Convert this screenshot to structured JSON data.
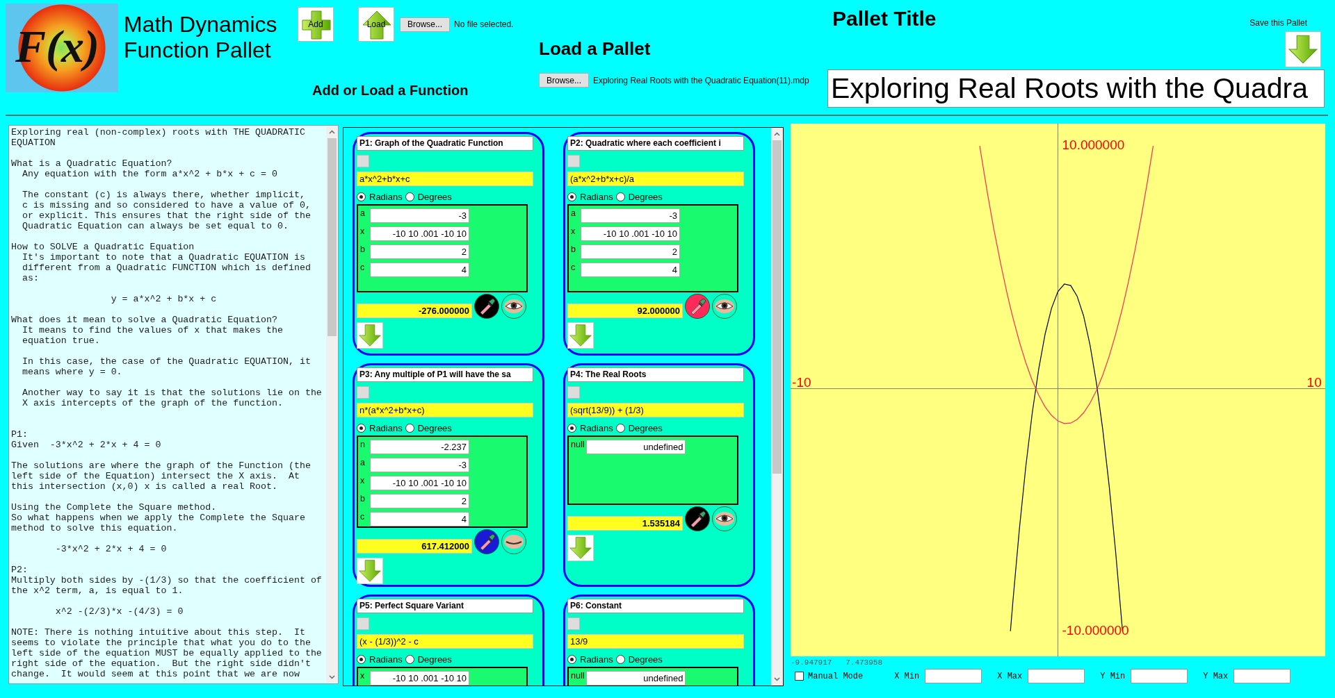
{
  "header": {
    "logo_text": "F(x)",
    "app_title": [
      "Math Dynamics",
      "Function Pallet"
    ],
    "add_button": "Add",
    "load_button": "Load",
    "function_browse": "Browse...",
    "function_file": "No file selected.",
    "function_caption": "Add or Load a Function",
    "pallet_heading": "Load a Pallet",
    "pallet_browse": "Browse...",
    "pallet_file": "Exploring Real Roots with the Quadratic Equation(11).mdp",
    "title_heading": "Pallet Title",
    "save_caption": "Save this Pallet",
    "title_value": "Exploring Real Roots with the Quadra"
  },
  "notes": {
    "text": "Exploring real (non-complex) roots with THE QUADRATIC\nEQUATION\n\nWhat is a Quadratic Equation?\n  Any equation with the form a*x^2 + b*x + c = 0\n\n  The constant (c) is always there, whether implicit,\n  c is missing and so considered to have a value of 0,\n  or explicit. This ensures that the right side of the\n  Quadratic Equation can always be set equal to 0.\n\nHow to SOLVE a Quadratic Equation\n  It's important to note that a Quadratic EQUATION is\n  different from a Quadratic FUNCTION which is defined\n  as:\n\n                  y = a*x^2 + b*x + c\n\nWhat does it mean to solve a Quadratic Equation?\n  It means to find the values of x that makes the\n  equation true.\n\n  In this case, the case of the Quadratic EQUATION, it\n  means where y = 0.\n\n  Another way to say it is that the solutions lie on the\n  X axis intercepts of the graph of the function.\n\n\nP1:\nGiven  -3*x^2 + 2*x + 4 = 0\n\nThe solutions are where the graph of the Function (the\nleft side of the Equation) intersect the X axis.  At\nthis intersection (x,0) x is called a real Root.\n\nUsing the Complete the Square method.\nSo what happens when we apply the Complete the Square\nmethod to solve this equation.\n\n        -3*x^2 + 2*x + 4 = 0\n\nP2:\nMultiply both sides by -(1/3) so that the coefficient of\nthe x^2 term, a, is equal to 1.\n\n        x^2 -(2/3)*x -(4/3) = 0\n\nNOTE: There is nothing intuitive about this step.  It\nseems to violate the principle that what you do to the\nleft side of the equation MUST be equally applied to the\nright side of the equation.  But the right side didn't\nchange.  It would seem at this point that we are now"
  },
  "cards": [
    {
      "title": "P1: Graph of the Quadratic Function",
      "formula": "a*x^2+b*x+c",
      "angle_units": [
        {
          "label": "Radians",
          "selected": true
        },
        {
          "label": "Degrees",
          "selected": false
        }
      ],
      "params": [
        {
          "label": "a",
          "value": "-3"
        },
        {
          "label": "x",
          "value": "-10 10 .001 -10 10"
        },
        {
          "label": "b",
          "value": "2"
        },
        {
          "label": "c",
          "value": "4"
        }
      ],
      "result": "-276.000000",
      "color": "#000000",
      "visible": true
    },
    {
      "title": "P2: Quadratic where each coefficient i",
      "formula": "(a*x^2+b*x+c)/a",
      "angle_units": [
        {
          "label": "Radians",
          "selected": true
        },
        {
          "label": "Degrees",
          "selected": false
        }
      ],
      "params": [
        {
          "label": "a",
          "value": "-3"
        },
        {
          "label": "x",
          "value": "-10 10 .001 -10 10"
        },
        {
          "label": "b",
          "value": "2"
        },
        {
          "label": "c",
          "value": "4"
        }
      ],
      "result": "92.000000",
      "color": "#ff2a5a",
      "visible": true
    },
    {
      "title": "P3: Any multiple of P1 will have the sa",
      "formula": "n*(a*x^2+b*x+c)",
      "angle_units": [
        {
          "label": "Radians",
          "selected": true
        },
        {
          "label": "Degrees",
          "selected": false
        }
      ],
      "params": [
        {
          "label": "n",
          "value": "-2.237"
        },
        {
          "label": "a",
          "value": "-3"
        },
        {
          "label": "x",
          "value": "-10 10 .001 -10 10"
        },
        {
          "label": "b",
          "value": "2"
        },
        {
          "label": "c",
          "value": "4"
        }
      ],
      "result": "617.412000",
      "color": "#1a1ad6",
      "visible": false
    },
    {
      "title": "P4: The Real Roots",
      "formula": "(sqrt(13/9)) + (1/3)",
      "angle_units": [
        {
          "label": "Radians",
          "selected": true
        },
        {
          "label": "Degrees",
          "selected": false
        }
      ],
      "params": [
        {
          "label": "null",
          "value": "undefined"
        }
      ],
      "result": "1.535184",
      "color": "#000000",
      "visible": true
    },
    {
      "title": "P5: Perfect Square Variant",
      "formula": "(x - (1/3))^2 -  c",
      "angle_units": [
        {
          "label": "Radians",
          "selected": true
        },
        {
          "label": "Degrees",
          "selected": false
        }
      ],
      "params": [
        {
          "label": "x",
          "value": "-10 10 .001 -10 10"
        }
      ]
    },
    {
      "title": "P6: Constant",
      "formula": "13/9",
      "angle_units": [
        {
          "label": "Radians",
          "selected": true
        },
        {
          "label": "Degrees",
          "selected": false
        }
      ],
      "params": [
        {
          "label": "null",
          "value": "undefined"
        }
      ]
    }
  ],
  "chart": {
    "chart_data": {
      "type": "line",
      "xlim": [
        -10.43,
        10.43
      ],
      "ylim": [
        -11.03,
        10.92
      ],
      "xticks": [
        {
          "value": -10,
          "label": "-10"
        },
        {
          "value": 10,
          "label": "10"
        }
      ],
      "yticks": [
        {
          "value": 10,
          "label": "10.000000"
        },
        {
          "value": -10,
          "label": "-10.000000"
        }
      ],
      "x": [
        -3.049,
        -3,
        -2.75,
        -2.5,
        -2.25,
        -2,
        -1.852,
        -1.75,
        -1.5,
        -1.25,
        -1,
        -0.75,
        -0.5,
        -0.25,
        0,
        0.25,
        0.5,
        0.75,
        1,
        1.25,
        1.5,
        1.75,
        2,
        2.25,
        2.5,
        2.519,
        2.75,
        3,
        3.25,
        3.5,
        3.716
      ],
      "series": [
        {
          "color": "#000000",
          "values": [
            null,
            null,
            null,
            null,
            null,
            null,
            -9.99,
            -8.69,
            -5.75,
            -3.19,
            -1,
            0.81,
            2.25,
            3.31,
            4,
            4.31,
            4.25,
            3.81,
            3,
            1.81,
            0.25,
            -1.69,
            -4,
            -6.69,
            -9.75,
            -10,
            null,
            null,
            null,
            null,
            null
          ]
        },
        {
          "color": "#ff2a5a",
          "values": [
            10,
            9.67,
            8.06,
            6.58,
            5.23,
            4,
            3.33,
            2.9,
            1.92,
            1.06,
            0.33,
            -0.27,
            -0.75,
            -1.1,
            -1.33,
            -1.44,
            -1.42,
            -1.27,
            -1,
            -0.6,
            -0.08,
            0.56,
            1.33,
            2.23,
            3.25,
            3.33,
            4.4,
            5.67,
            7.06,
            8.58,
            10
          ]
        }
      ]
    },
    "cursor": "-9.947917   7.473958",
    "manual_mode": {
      "label": "Manual Mode",
      "checked": false
    },
    "range_fields": [
      "X Min",
      "X Max",
      "Y Min",
      "Y Max"
    ]
  }
}
